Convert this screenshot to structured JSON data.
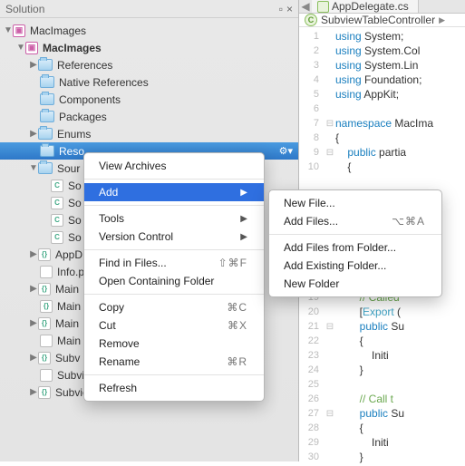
{
  "sidebar": {
    "title": "Solution",
    "root": "MacImages",
    "project": "MacImages",
    "folders": [
      "References",
      "Native References",
      "Components",
      "Packages",
      "Enums"
    ],
    "selected": "Reso",
    "sourcesLabel": "Sour",
    "srcItems": [
      "So",
      "So",
      "So",
      "So"
    ],
    "files": [
      "AppD",
      "Info.p",
      "Main",
      "Main",
      "Main",
      "Main",
      "Subv",
      "SubviewTable.xib",
      "SubviewTableController.cs"
    ]
  },
  "tab": {
    "title": "AppDelegate.cs"
  },
  "breadcrumb": {
    "item": "SubviewTableController",
    "sep": "▶"
  },
  "code": {
    "lines": [
      {
        "n": 1,
        "t": "using System;"
      },
      {
        "n": 2,
        "t": "using System.Col"
      },
      {
        "n": 3,
        "t": "using System.Lin"
      },
      {
        "n": 4,
        "t": "using Foundation;"
      },
      {
        "n": 5,
        "t": "using AppKit;"
      },
      {
        "n": 6,
        "t": ""
      },
      {
        "n": 7,
        "t": "namespace MacIma",
        "f": "-"
      },
      {
        "n": 8,
        "t": "{"
      },
      {
        "n": 9,
        "t": "    public partia",
        "f": "-"
      },
      {
        "n": 10,
        "t": "    {"
      },
      {
        "n": "",
        "t": ""
      },
      {
        "n": "",
        "t": ""
      },
      {
        "n": "",
        "t": ""
      },
      {
        "n": "",
        "t": ""
      },
      {
        "n": "",
        "t": ""
      },
      {
        "n": "",
        "t": ""
      },
      {
        "n": "",
        "t": ""
      },
      {
        "n": "",
        "t": ""
      },
      {
        "n": 19,
        "t": "        // Called"
      },
      {
        "n": 20,
        "t": "        [Export ("
      },
      {
        "n": 21,
        "t": "        public Su",
        "f": "-"
      },
      {
        "n": 22,
        "t": "        {"
      },
      {
        "n": 23,
        "t": "            Initi"
      },
      {
        "n": 24,
        "t": "        }"
      },
      {
        "n": 25,
        "t": ""
      },
      {
        "n": 26,
        "t": "        // Call t"
      },
      {
        "n": 27,
        "t": "        public Su",
        "f": "-"
      },
      {
        "n": 28,
        "t": "        {"
      },
      {
        "n": 29,
        "t": "            Initi"
      },
      {
        "n": 30,
        "t": "        }"
      }
    ]
  },
  "menu1": {
    "items": [
      {
        "label": "View Archives"
      },
      {
        "sep": true
      },
      {
        "label": "Add",
        "arrow": true,
        "hi": true
      },
      {
        "sep": true
      },
      {
        "label": "Tools",
        "arrow": true
      },
      {
        "label": "Version Control",
        "arrow": true
      },
      {
        "sep": true
      },
      {
        "label": "Find in Files...",
        "sc": "⇧⌘F"
      },
      {
        "label": "Open Containing Folder"
      },
      {
        "sep": true
      },
      {
        "label": "Copy",
        "sc": "⌘C"
      },
      {
        "label": "Cut",
        "sc": "⌘X"
      },
      {
        "label": "Remove"
      },
      {
        "label": "Rename",
        "sc": "⌘R"
      },
      {
        "sep": true
      },
      {
        "label": "Refresh"
      }
    ]
  },
  "menu2": {
    "items": [
      {
        "label": "New File..."
      },
      {
        "label": "Add Files...",
        "sc": "⌥⌘A"
      },
      {
        "sep": true
      },
      {
        "label": "Add Files from Folder..."
      },
      {
        "label": "Add Existing Folder..."
      },
      {
        "label": "New Folder"
      }
    ]
  }
}
